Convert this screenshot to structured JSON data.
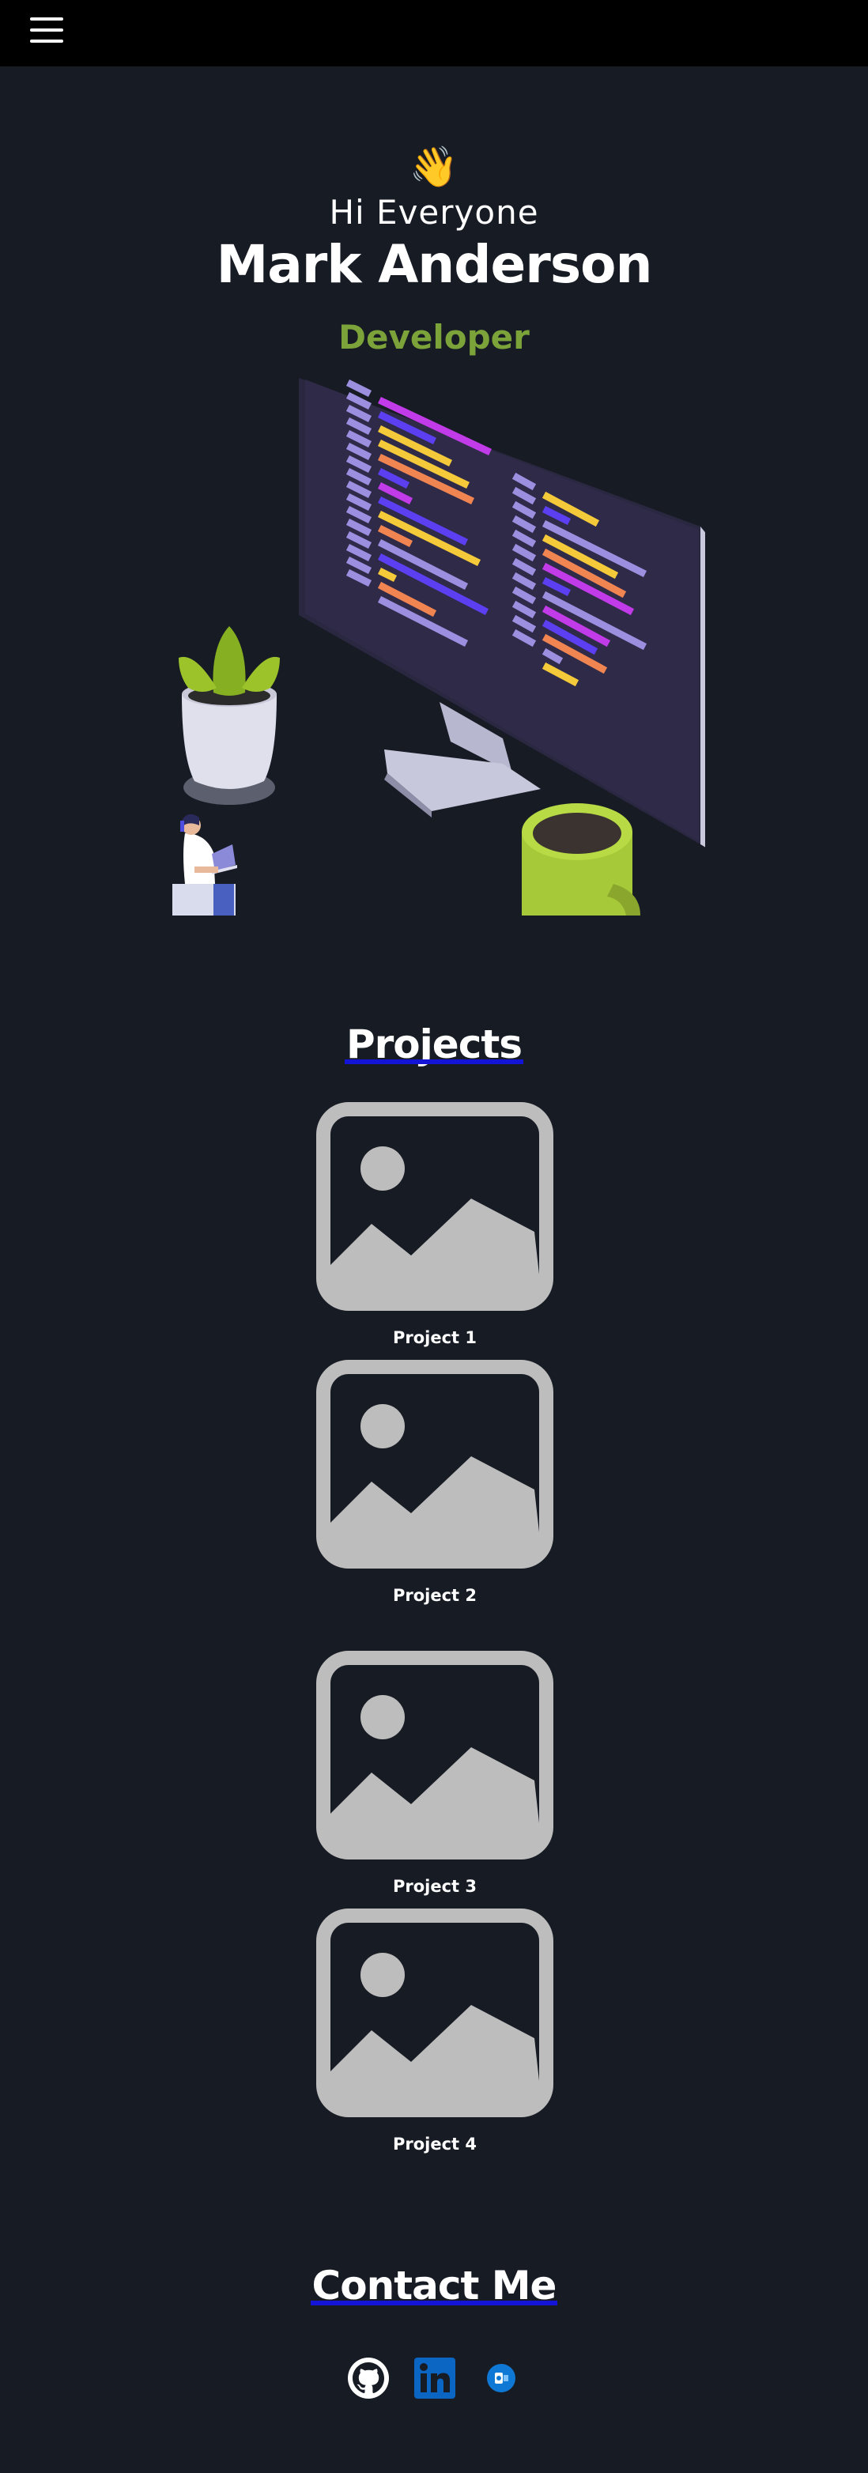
{
  "header": {
    "menu_icon": "hamburger-menu-icon",
    "background": "#000000"
  },
  "hero": {
    "emoji": "👋",
    "greeting": "Hi Everyone",
    "name": "Mark Anderson",
    "role": "Developer",
    "role_color": "#7ba33a",
    "illustration": "developer-workspace-illustration"
  },
  "projects": {
    "title": "Projects",
    "underline_color": "#1414d6",
    "items": [
      {
        "label": "Project 1",
        "thumbnail_icon": "image-placeholder-icon"
      },
      {
        "label": "Project 2",
        "thumbnail_icon": "image-placeholder-icon"
      },
      {
        "label": "Project 3",
        "thumbnail_icon": "image-placeholder-icon"
      },
      {
        "label": "Project 4",
        "thumbnail_icon": "image-placeholder-icon"
      }
    ]
  },
  "contact": {
    "title": "Contact Me",
    "links": [
      {
        "icon": "github-icon"
      },
      {
        "icon": "linkedin-icon"
      },
      {
        "icon": "outlook-mail-icon"
      }
    ]
  },
  "colors": {
    "page_background": "#171b24",
    "placeholder": "#bdbdbd",
    "linkedin": "#0a66c2",
    "outlook": "#0f78d4"
  }
}
